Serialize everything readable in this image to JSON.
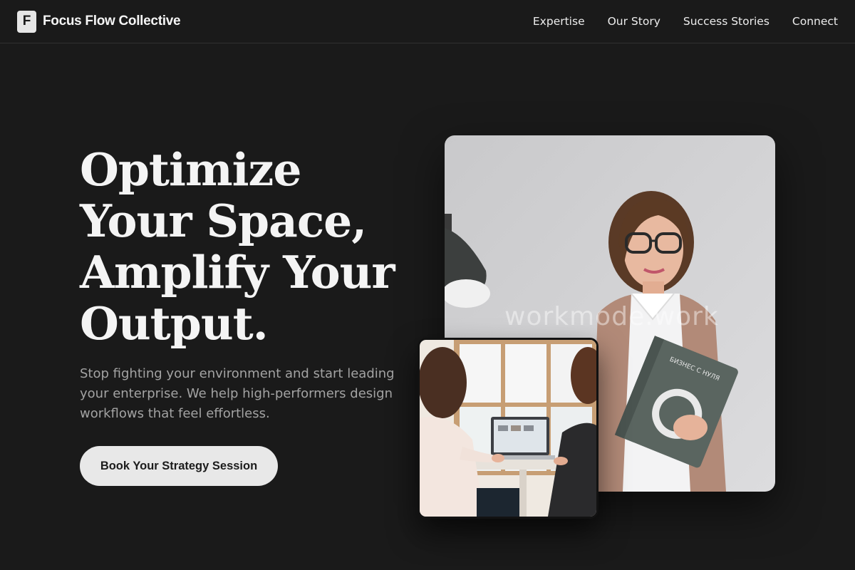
{
  "header": {
    "logo_letter": "F",
    "brand_name": "Focus Flow Collective",
    "nav": [
      {
        "label": "Expertise"
      },
      {
        "label": "Our Story"
      },
      {
        "label": "Success Stories"
      },
      {
        "label": "Connect"
      }
    ]
  },
  "hero": {
    "headline_lines": [
      "Optimize",
      "Your Space,",
      "Amplify Your",
      "Output."
    ],
    "subtext": "Stop fighting your environment and start leading your enterprise. We help high-performers design workflows that feel effortless.",
    "cta_label": "Book Your Strategy Session"
  },
  "images": {
    "main_watermark": "workmode.work",
    "book_title": "БИЗНЕС С НУЛЯ"
  },
  "colors": {
    "background": "#1a1a1a",
    "text_primary": "#f4f4f4",
    "text_muted": "#a3a3a3",
    "button_bg": "#e8e8e8"
  }
}
